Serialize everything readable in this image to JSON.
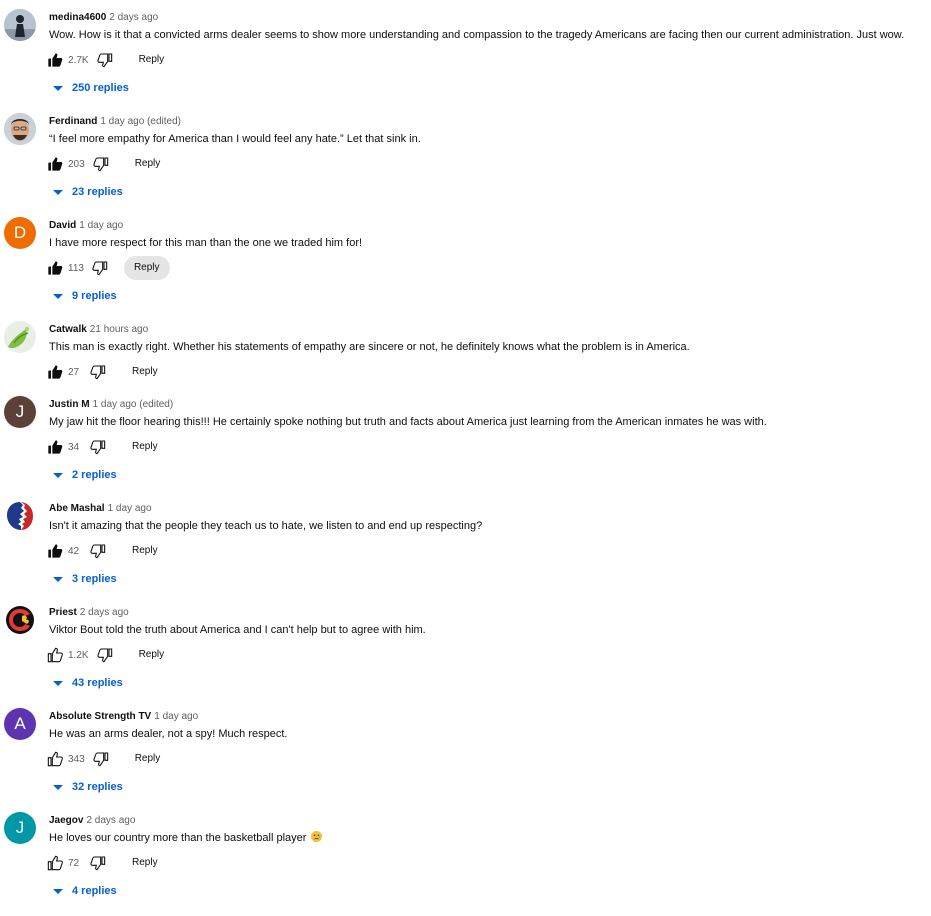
{
  "comments": [
    {
      "author": "medina4600",
      "time": "2 days ago",
      "text": "Wow. How is it that a convicted arms dealer seems to show more understanding and compassion to the tragedy Americans are facing then our current administration. Just wow.",
      "likes": "2.7K",
      "reply_label": "Reply",
      "replies": "250 replies",
      "avatar_type": "photo-person-dark",
      "liked": true
    },
    {
      "author": "Ferdinand",
      "time": "1 day ago (edited)",
      "text": "“I feel more empathy for America than I would feel any hate.” Let that sink in.",
      "likes": "203",
      "reply_label": "Reply",
      "replies": "23 replies",
      "avatar_type": "photo-face",
      "liked": true
    },
    {
      "author": "David",
      "time": "1 day ago",
      "text": "I have more respect for this man than the one we traded him for!",
      "likes": "113",
      "reply_label": "Reply",
      "replies": "9 replies",
      "avatar_type": "letter",
      "avatar_letter": "D",
      "avatar_color": "#ef6c00",
      "liked": true
    },
    {
      "author": "Catwalk",
      "time": "21 hours ago",
      "text": "This man is exactly right. Whether his statements of empathy are sincere or not, he definitely knows what the problem is in America.",
      "likes": "27",
      "reply_label": "Reply",
      "replies": "",
      "avatar_type": "photo-green",
      "liked": true
    },
    {
      "author": "Justin M",
      "time": "1 day ago (edited)",
      "text": "My jaw hit the floor hearing this!!!  He certainly spoke nothing but truth and facts about America just learning from the American inmates he was with.",
      "likes": "34",
      "reply_label": "Reply",
      "replies": "2 replies",
      "avatar_type": "letter",
      "avatar_letter": "J",
      "avatar_color": "#5d4037",
      "liked": true
    },
    {
      "author": "Abe Mashal",
      "time": "1 day ago",
      "text": "Isn't it amazing that the people they teach us to hate, we listen to and end up respecting?",
      "likes": "42",
      "reply_label": "Reply",
      "replies": "3 replies",
      "avatar_type": "logo-profile",
      "liked": true
    },
    {
      "author": "Priest",
      "time": "2 days ago",
      "text": "Viktor Bout told the truth about America and I can't help but to agree with him.",
      "likes": "1.2K",
      "reply_label": "Reply",
      "replies": "43 replies",
      "avatar_type": "logo-flame",
      "liked": false
    },
    {
      "author": "Absolute Strength TV",
      "time": "1 day ago",
      "text": "He was an arms dealer, not a spy! Much respect.",
      "likes": "343",
      "reply_label": "Reply",
      "replies": "32 replies",
      "avatar_type": "letter",
      "avatar_letter": "A",
      "avatar_color": "#5e35b1",
      "liked": false
    },
    {
      "author": "Jaegov",
      "time": "2 days ago",
      "text": "He loves our country more than the basketball player",
      "likes": "72",
      "reply_label": "Reply",
      "replies": "4 replies",
      "avatar_type": "letter",
      "avatar_letter": "J",
      "avatar_color": "#0097a7",
      "liked": false,
      "has_emoji": true
    }
  ],
  "colors": {
    "link_blue": "#065fd4",
    "secondary_text": "#606060",
    "reply_hover_bg": "#e5e5e5"
  }
}
